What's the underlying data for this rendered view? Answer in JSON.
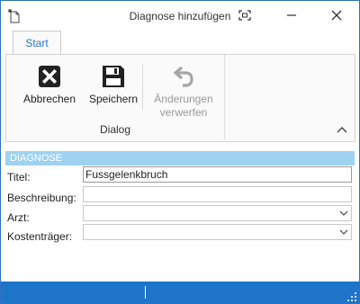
{
  "window": {
    "title": "Diagnose hinzufügen"
  },
  "ribbon": {
    "tabs": [
      {
        "label": "Start",
        "active": true
      }
    ],
    "group_label": "Dialog",
    "buttons": {
      "cancel": {
        "label": "Abbrechen",
        "icon": "cancel-x-icon",
        "enabled": true
      },
      "save": {
        "label": "Speichern",
        "icon": "floppy-disk-icon",
        "enabled": true
      },
      "revert": {
        "label_line1": "Änderungen",
        "label_line2": "verwerfen",
        "icon": "undo-arrow-icon",
        "enabled": false
      }
    }
  },
  "section": {
    "title": "DIAGNOSE"
  },
  "form": {
    "title_label": "Titel:",
    "title_value": "Fussgelenkbruch",
    "description_label": "Beschreibung:",
    "description_value": "",
    "doctor_label": "Arzt:",
    "doctor_value": "",
    "payer_label": "Kostenträger:",
    "payer_value": ""
  },
  "colors": {
    "accent": "#2b72c2",
    "section_header": "#9fd2f0",
    "statusbar": "#1e74c8"
  }
}
